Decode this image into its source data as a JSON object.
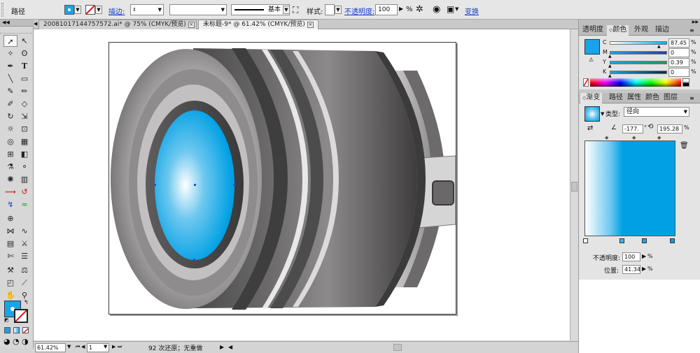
{
  "control_bar": {
    "object_type": "路径",
    "stroke_label": "描边:",
    "stroke_profile": "基本",
    "style_label": "样式:",
    "opacity_label": "不透明度:",
    "opacity_value": "100",
    "opacity_unit": "%",
    "transform_label": "变换",
    "fill_color": "#1aa3e8"
  },
  "document_tabs": [
    {
      "title": "20081017144757572.ai* @ 75% (CMYK/预览)",
      "active": false
    },
    {
      "title": "未标题-9* @ 61.42% (CMYK/预览)",
      "active": true
    }
  ],
  "tools": [
    "selection-tool",
    "direct-selection-tool",
    "magic-wand-tool",
    "lasso-tool",
    "pen-tool",
    "type-tool",
    "line-tool",
    "rectangle-tool",
    "paintbrush-tool",
    "pencil-tool",
    "blob-brush-tool",
    "eraser-tool",
    "rotate-tool",
    "scale-tool",
    "warp-tool",
    "free-transform-tool",
    "shape-builder-tool",
    "perspective-grid-tool",
    "mesh-tool",
    "gradient-tool",
    "eyedropper-tool",
    "blend-tool",
    "symbol-sprayer-tool",
    "column-graph-tool",
    "artboard-tool",
    "slice-tool",
    "hand-tool",
    "zoom-tool"
  ],
  "status_bar": {
    "zoom": "61.42%",
    "page": "1",
    "undo_text": "92 次还原；无重做"
  },
  "color_panel": {
    "tabs": [
      "透明度",
      "颜色",
      "外观",
      "描边"
    ],
    "active_tab": "颜色",
    "channels": [
      {
        "label": "C",
        "value": "87.45",
        "color": "#00aeef"
      },
      {
        "label": "M",
        "value": "0",
        "color": "#ec008c"
      },
      {
        "label": "Y",
        "value": "0.39",
        "color": "#fff200"
      },
      {
        "label": "K",
        "value": "0",
        "color": "#231f20"
      }
    ],
    "swatch_color": "#1aa3e8"
  },
  "gradient_panel": {
    "tabs": [
      "渐变",
      "路径",
      "属性",
      "颜色",
      "图层"
    ],
    "active_tab": "渐变",
    "type_label": "类型:",
    "type_value": "径向",
    "angle_value": "-177.",
    "angle_unit": "°",
    "ratio_value": "195.28",
    "ratio_unit": "%",
    "opacity_label": "不透明度:",
    "opacity_value": "100",
    "opacity_unit": "%",
    "position_label": "位置:",
    "position_value": "41.34",
    "position_unit": "%",
    "start_color": "#ffffff",
    "end_color": "#00a0e4"
  }
}
